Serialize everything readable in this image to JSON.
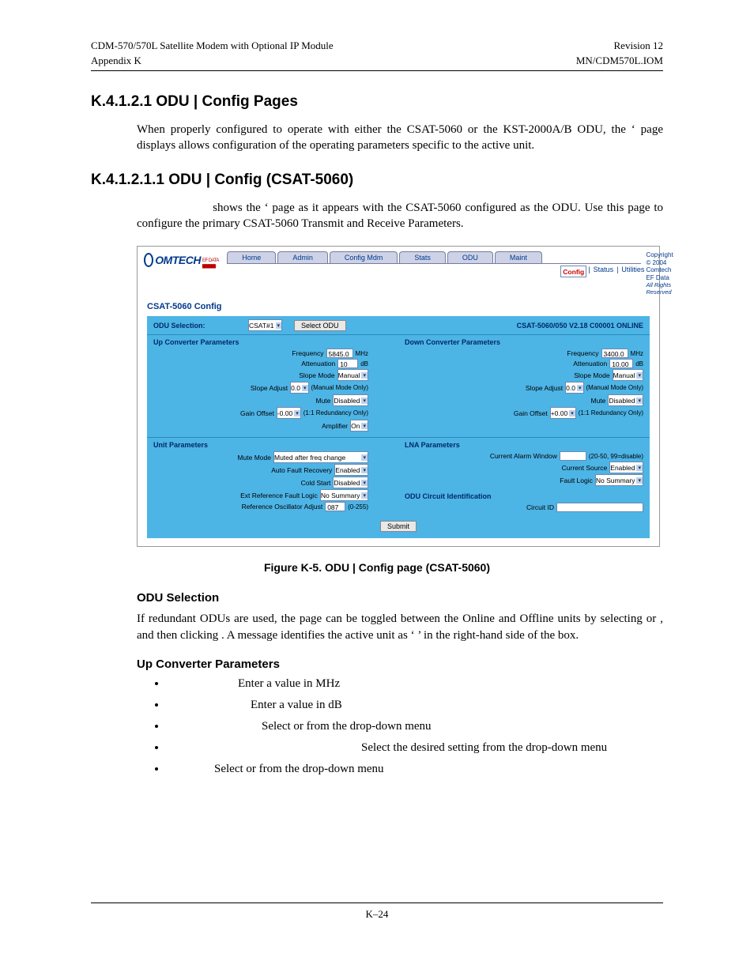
{
  "header": {
    "left1": "CDM-570/570L Satellite Modem with Optional IP Module",
    "left2": "Appendix K",
    "right1": "Revision 12",
    "right2": "MN/CDM570L.IOM"
  },
  "section1": {
    "num_title": "K.4.1.2.1  ODU | Config Pages",
    "para": "When properly configured to operate with either the CSAT-5060 or the KST-2000A/B ODU, the ‘                       page displays allows configuration of the operating parameters specific to the active unit."
  },
  "section2": {
    "num_title": "K.4.1.2.1.1  ODU | Config (CSAT-5060)",
    "para": "shows the ‘                            page as it appears with the CSAT-5060 configured as the ODU. Use this page to configure the primary CSAT-5060 Transmit and Receive Parameters."
  },
  "shot": {
    "logo_text": "OMTECH",
    "logo_sub": "EF DATA ▆▆▆▆.",
    "tabs": [
      "Home",
      "Admin",
      "Config Mdm",
      "Stats",
      "ODU",
      "Maint"
    ],
    "subtabs": {
      "sel": "Config",
      "a": "Status",
      "b": "Utilities",
      "divider": "|"
    },
    "copyright": {
      "l1": "Copyright © 2004",
      "l2": "Comtech EF Data",
      "l3": "All Rights Reserved"
    },
    "title": "CSAT-5060 Config",
    "odu_selection": {
      "label": "ODU Selection:",
      "value": "CSAT#1",
      "button": "Select ODU",
      "status": "CSAT-5060/050 V2.18 C00001 ONLINE"
    },
    "up": {
      "title": "Up Converter Parameters",
      "f": {
        "(k)": "Frequency",
        "v": "5845.0",
        "u": "MHz"
      },
      "a": {
        "k": "Attenuation",
        "v": "10",
        "u": "dB"
      },
      "sm": {
        "k": "Slope Mode",
        "v": "Manual"
      },
      "sa": {
        "k": "Slope Adjust",
        "v": "0.0",
        "hint": "(Manual Mode Only)"
      },
      "m": {
        "k": "Mute",
        "v": "Disabled"
      },
      "go": {
        "k": "Gain Offset",
        "v": "-0.00",
        "hint": "(1:1 Redundancy Only)"
      },
      "amp": {
        "k": "Amplifier",
        "v": "On"
      }
    },
    "dn": {
      "title": "Down Converter Parameters",
      "f": {
        "k": "Frequency",
        "v": "3400.0",
        "u": "MHz"
      },
      "a": {
        "k": "Attenuation",
        "v": "10.00",
        "u": "dB"
      },
      "sm": {
        "k": "Slope Mode",
        "v": "Manual"
      },
      "sa": {
        "k": "Slope Adjust",
        "v": "0.0",
        "hint": "(Manual Mode Only)"
      },
      "m": {
        "k": "Mute",
        "v": "Disabled"
      },
      "go": {
        "k": "Gain Offset",
        "v": "+0.00",
        "hint": "(1:1 Redundancy Only)"
      }
    },
    "unit": {
      "title": "Unit Parameters",
      "mm": {
        "k": "Mute Mode",
        "v": "Muted after freq change"
      },
      "afr": {
        "k": "Auto Fault Recovery",
        "v": "Enabled"
      },
      "cs": {
        "k": "Cold Start",
        "v": "Disabled"
      },
      "erfl": {
        "k": "Ext Reference Fault Logic",
        "v": "No Summary"
      },
      "roa": {
        "k": "Reference Oscillator Adjust",
        "v": "087",
        "hint": "(0-255)"
      }
    },
    "lna": {
      "title": "LNA Parameters",
      "caw": {
        "k": "Current Alarm Window",
        "v": "",
        "hint": "(20-50, 99=disable)"
      },
      "cs": {
        "k": "Current Source",
        "v": "Enabled"
      },
      "fl": {
        "k": "Fault Logic",
        "v": "No Summary"
      }
    },
    "oci": {
      "title": "ODU Circuit Identification",
      "k": "Circuit ID",
      "v": ""
    },
    "submit": "Submit"
  },
  "caption": "Figure K-5. ODU | Config page (CSAT-5060)",
  "odu_sel": {
    "h": "ODU Selection",
    "p": "If redundant ODUs are used, the page can be toggled between the Online and Offline units by selecting                or               , and then clicking                 . A message identifies the active unit as ‘                ’ in the right-hand side of the box."
  },
  "upc": {
    "h": "Up Converter Parameters",
    "items": [
      "Enter a value in MHz",
      "Enter a value in dB",
      "Select              or                    from the drop-down menu",
      "Select the desired setting from the drop-down menu",
      "Select              or                   from the drop-down menu"
    ]
  },
  "footer": "K–24"
}
